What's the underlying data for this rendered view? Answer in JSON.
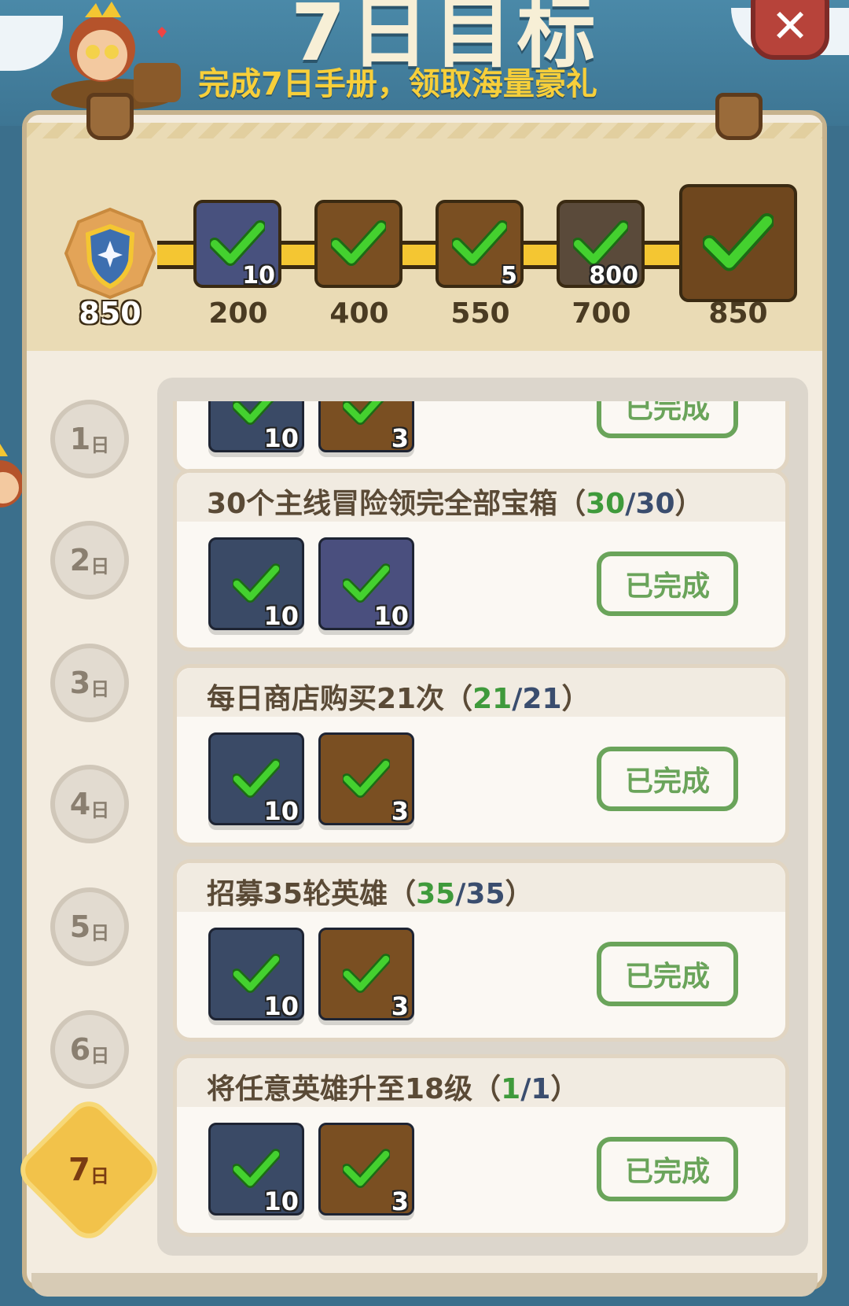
{
  "header": {
    "title": "7日目标",
    "subtitle": "完成7日手册，领取海量豪礼",
    "close_label": "✕"
  },
  "progress": {
    "current_score": "850",
    "milestones": [
      {
        "points": "200",
        "qty": "10",
        "kind": "integral-book",
        "claimed": true
      },
      {
        "points": "400",
        "qty": "",
        "kind": "medal-coin",
        "claimed": true
      },
      {
        "points": "550",
        "qty": "5",
        "kind": "hammer",
        "claimed": true
      },
      {
        "points": "700",
        "qty": "800",
        "kind": "diamond",
        "claimed": true
      },
      {
        "points": "850",
        "qty": "",
        "kind": "treasure-chest",
        "claimed": true
      }
    ]
  },
  "days": [
    {
      "num": "1",
      "unit": "日"
    },
    {
      "num": "2",
      "unit": "日"
    },
    {
      "num": "3",
      "unit": "日"
    },
    {
      "num": "4",
      "unit": "日"
    },
    {
      "num": "5",
      "unit": "日"
    },
    {
      "num": "6",
      "unit": "日"
    },
    {
      "num": "7",
      "unit": "日",
      "active": true
    }
  ],
  "tasks": [
    {
      "title": "",
      "progress_current": "",
      "progress_total": "",
      "rewards": [
        {
          "kind": "shield-badge",
          "qty": "10"
        },
        {
          "kind": "hero-stone",
          "qty": "3"
        }
      ],
      "status": "已完成"
    },
    {
      "title": "30个主线冒险领完全部宝箱",
      "progress_current": "30",
      "progress_total": "30",
      "rewards": [
        {
          "kind": "shield-badge",
          "qty": "10"
        },
        {
          "kind": "integral-book",
          "qty": "10"
        }
      ],
      "status": "已完成"
    },
    {
      "title": "每日商店购买21次",
      "progress_current": "21",
      "progress_total": "21",
      "rewards": [
        {
          "kind": "shield-badge",
          "qty": "10"
        },
        {
          "kind": "hero-stone",
          "qty": "3"
        }
      ],
      "status": "已完成"
    },
    {
      "title": "招募35轮英雄",
      "progress_current": "35",
      "progress_total": "35",
      "rewards": [
        {
          "kind": "shield-badge",
          "qty": "10"
        },
        {
          "kind": "hero-stone",
          "qty": "3"
        }
      ],
      "status": "已完成"
    },
    {
      "title": "将任意英雄升至18级",
      "progress_current": "1",
      "progress_total": "1",
      "rewards": [
        {
          "kind": "shield-badge",
          "qty": "10"
        },
        {
          "kind": "hero-stone",
          "qty": "3"
        }
      ],
      "status": "已完成"
    }
  ],
  "colors": {
    "accent_yellow": "#f4c632",
    "progress_green": "#3f9a3b",
    "done_green": "#6aa45a",
    "close_red": "#b7433a"
  }
}
